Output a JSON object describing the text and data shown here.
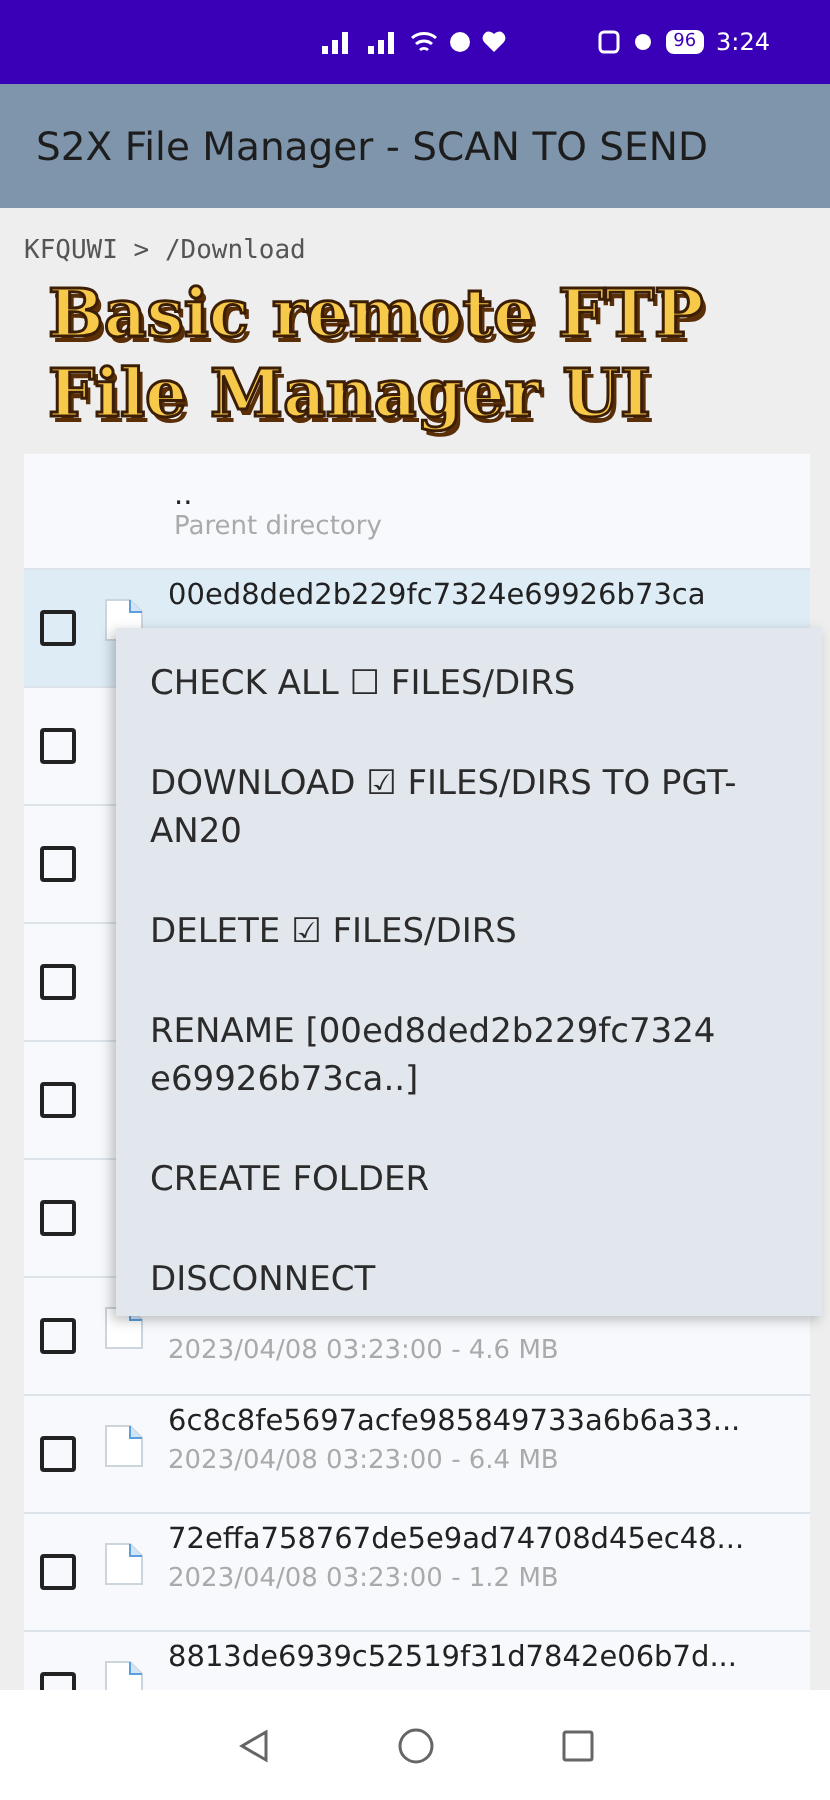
{
  "status_bar": {
    "battery": "96",
    "time": "3:24"
  },
  "app_bar": {
    "title": "S2X File Manager - SCAN TO SEND"
  },
  "path": "KFQUWI > /Download",
  "caption": {
    "lines": [
      "Basic remote FTP",
      "File Manager UI"
    ]
  },
  "parent_row": {
    "name": "..",
    "meta": "Parent directory"
  },
  "files": [
    {
      "name": "00ed8ded2b229fc7324e69926b73ca",
      "checked": false,
      "selected": true
    },
    {
      "checked": false,
      "selected": false
    },
    {
      "checked": false,
      "selected": false
    },
    {
      "checked": false,
      "selected": false
    },
    {
      "checked": false,
      "selected": false
    },
    {
      "checked": false,
      "selected": false
    },
    {
      "meta": "2023/04/08 03:23:00  - 4.6 MB",
      "checked": false,
      "selected": false
    },
    {
      "name": "6c8c8fe5697acfe985849733a6b6a33...",
      "meta": "2023/04/08 03:23:00  - 6.4 MB",
      "checked": false,
      "selected": false
    },
    {
      "name": "72effa758767de5e9ad74708d45ec48...",
      "meta": "2023/04/08 03:23:00  - 1.2 MB",
      "checked": false,
      "selected": false
    },
    {
      "name": "8813de6939c52519f31d7842e06b7d...",
      "checked": false,
      "selected": false
    }
  ],
  "menu": {
    "items": [
      "CHECK ALL ☐ FILES/DIRS",
      "DOWNLOAD ☑ FILES/DIRS TO PGT-AN20",
      "DELETE ☑ FILES/DIRS",
      "RENAME [00ed8ded2b229fc7324 e69926b73ca..]",
      "CREATE FOLDER",
      "DISCONNECT"
    ]
  }
}
